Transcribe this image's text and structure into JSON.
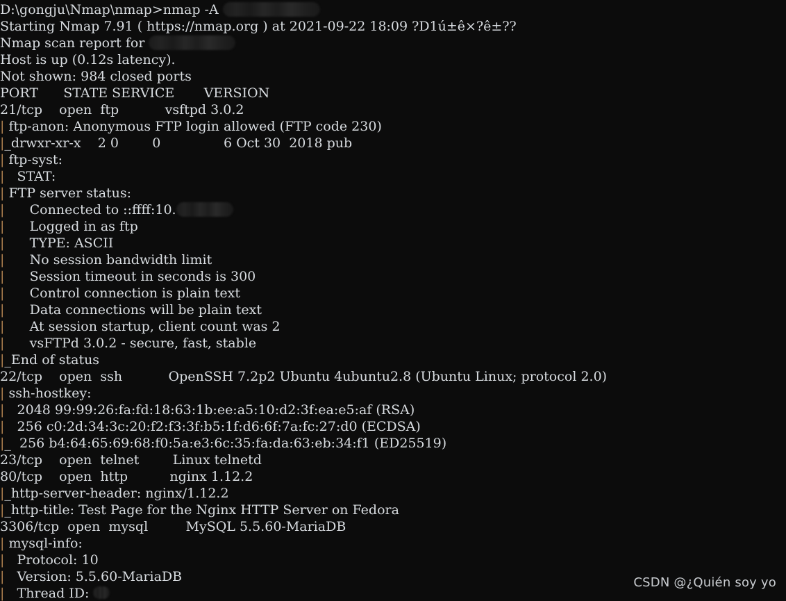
{
  "terminal": {
    "background_color": "#0c0c0c",
    "text_color": "#d8dce0",
    "pipe_color": "#b08050",
    "lines": [
      {
        "id": "prompt-command",
        "text": "D:\\gongju\\Nmap\\nmap>nmap -A ",
        "redaction": "cmd"
      },
      {
        "id": "starting-nmap",
        "text": "Starting Nmap 7.91 ( https://nmap.org ) at 2021-09-22 18:09 ?D1ú±ê×?ê±??"
      },
      {
        "id": "scan-report-for",
        "text": "Nmap scan report for ",
        "redaction": "host"
      },
      {
        "id": "host-is-up",
        "text": "Host is up (0.12s latency)."
      },
      {
        "id": "not-shown",
        "text": "Not shown: 984 closed ports"
      },
      {
        "id": "port-table-header",
        "text": "PORT      STATE SERVICE       VERSION"
      },
      {
        "id": "port-21-ftp",
        "text": "21/tcp    open  ftp           vsftpd 3.0.2"
      },
      {
        "id": "ftp-anon",
        "text": "| ftp-anon: Anonymous FTP login allowed (FTP code 230)",
        "pipe": true
      },
      {
        "id": "ftp-anon-listing",
        "text": "|_drwxr-xr-x    2 0        0               6 Oct 30  2018 pub",
        "pipe": true
      },
      {
        "id": "ftp-syst",
        "text": "| ftp-syst: ",
        "pipe": true
      },
      {
        "id": "ftp-syst-stat",
        "text": "|   STAT: ",
        "pipe": true
      },
      {
        "id": "ftp-server-status",
        "text": "| FTP server status:",
        "pipe": true
      },
      {
        "id": "ftp-connected-to",
        "text": "|      Connected to ::ffff:10.",
        "pipe": true,
        "redaction": "ip"
      },
      {
        "id": "ftp-logged-in",
        "text": "|      Logged in as ftp",
        "pipe": true
      },
      {
        "id": "ftp-type",
        "text": "|      TYPE: ASCII",
        "pipe": true
      },
      {
        "id": "ftp-no-bandwidth",
        "text": "|      No session bandwidth limit",
        "pipe": true
      },
      {
        "id": "ftp-session-timeout",
        "text": "|      Session timeout in seconds is 300",
        "pipe": true
      },
      {
        "id": "ftp-control-conn",
        "text": "|      Control connection is plain text",
        "pipe": true
      },
      {
        "id": "ftp-data-conn",
        "text": "|      Data connections will be plain text",
        "pipe": true
      },
      {
        "id": "ftp-client-count",
        "text": "|      At session startup, client count was 2",
        "pipe": true
      },
      {
        "id": "ftp-vsftpd-banner",
        "text": "|      vsFTPd 3.0.2 - secure, fast, stable",
        "pipe": true
      },
      {
        "id": "ftp-end-of-status",
        "text": "|_End of status",
        "pipe": true
      },
      {
        "id": "port-22-ssh",
        "text": "22/tcp    open  ssh           OpenSSH 7.2p2 Ubuntu 4ubuntu2.8 (Ubuntu Linux; protocol 2.0)"
      },
      {
        "id": "ssh-hostkey",
        "text": "| ssh-hostkey: ",
        "pipe": true
      },
      {
        "id": "ssh-hostkey-rsa",
        "text": "|   2048 99:99:26:fa:fd:18:63:1b:ee:a5:10:d2:3f:ea:e5:af (RSA)",
        "pipe": true
      },
      {
        "id": "ssh-hostkey-ecdsa",
        "text": "|   256 c0:2d:34:3c:20:f2:f3:3f:b5:1f:d6:6f:7a:fc:27:d0 (ECDSA)",
        "pipe": true
      },
      {
        "id": "ssh-hostkey-ed25519",
        "text": "|_  256 b4:64:65:69:68:f0:5a:e3:6c:35:fa:da:63:eb:34:f1 (ED25519)",
        "pipe": true
      },
      {
        "id": "port-23-telnet",
        "text": "23/tcp    open  telnet        Linux telnetd"
      },
      {
        "id": "port-80-http",
        "text": "80/tcp    open  http          nginx 1.12.2"
      },
      {
        "id": "http-server-header",
        "text": "|_http-server-header: nginx/1.12.2",
        "pipe": true
      },
      {
        "id": "http-title",
        "text": "|_http-title: Test Page for the Nginx HTTP Server on Fedora",
        "pipe": true
      },
      {
        "id": "port-3306-mysql",
        "text": "3306/tcp  open  mysql         MySQL 5.5.60-MariaDB"
      },
      {
        "id": "mysql-info",
        "text": "| mysql-info: ",
        "pipe": true
      },
      {
        "id": "mysql-protocol",
        "text": "|   Protocol: 10",
        "pipe": true
      },
      {
        "id": "mysql-version",
        "text": "|   Version: 5.5.60-MariaDB",
        "pipe": true
      },
      {
        "id": "mysql-thread-id",
        "text": "|   Thread ID: ",
        "pipe": true,
        "redaction": "tid"
      }
    ]
  },
  "watermark": {
    "text": "CSDN @¿Quién soy yo"
  }
}
